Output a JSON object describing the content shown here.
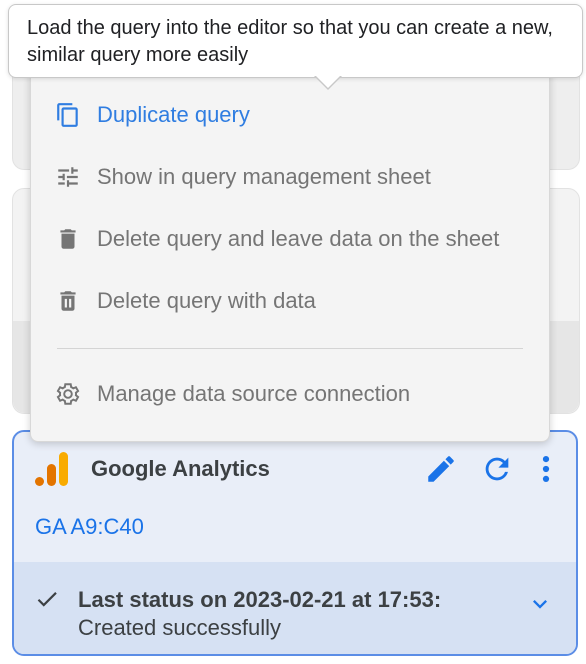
{
  "tooltip": {
    "text": "Load the query into the editor so that you can create a new, similar query more easily"
  },
  "menu": {
    "items": [
      {
        "label": "Duplicate query",
        "icon": "copy-icon",
        "active": true
      },
      {
        "label": "Show in query management sheet",
        "icon": "tune-icon",
        "active": false
      },
      {
        "label": "Delete query and leave data on the sheet",
        "icon": "trash-icon",
        "active": false
      },
      {
        "label": "Delete query with data",
        "icon": "trash-outline-icon",
        "active": false
      },
      {
        "label": "Manage data source connection",
        "icon": "gear-icon",
        "active": false
      }
    ]
  },
  "ga_card": {
    "title": "Google Analytics",
    "range": "GA A9:C40",
    "status_line1": "Last status on 2023-02-21 at 17:53:",
    "status_line2": "Created successfully",
    "icons": [
      "analytics-logo-icon",
      "edit-icon",
      "refresh-icon",
      "more-vert-icon",
      "check-icon",
      "chevron-down-icon"
    ]
  },
  "colors": {
    "accent": "#1a73e8",
    "logo_orange": "#f9ab00",
    "logo_dark_orange": "#e37400",
    "card_border": "#5b8de6"
  }
}
